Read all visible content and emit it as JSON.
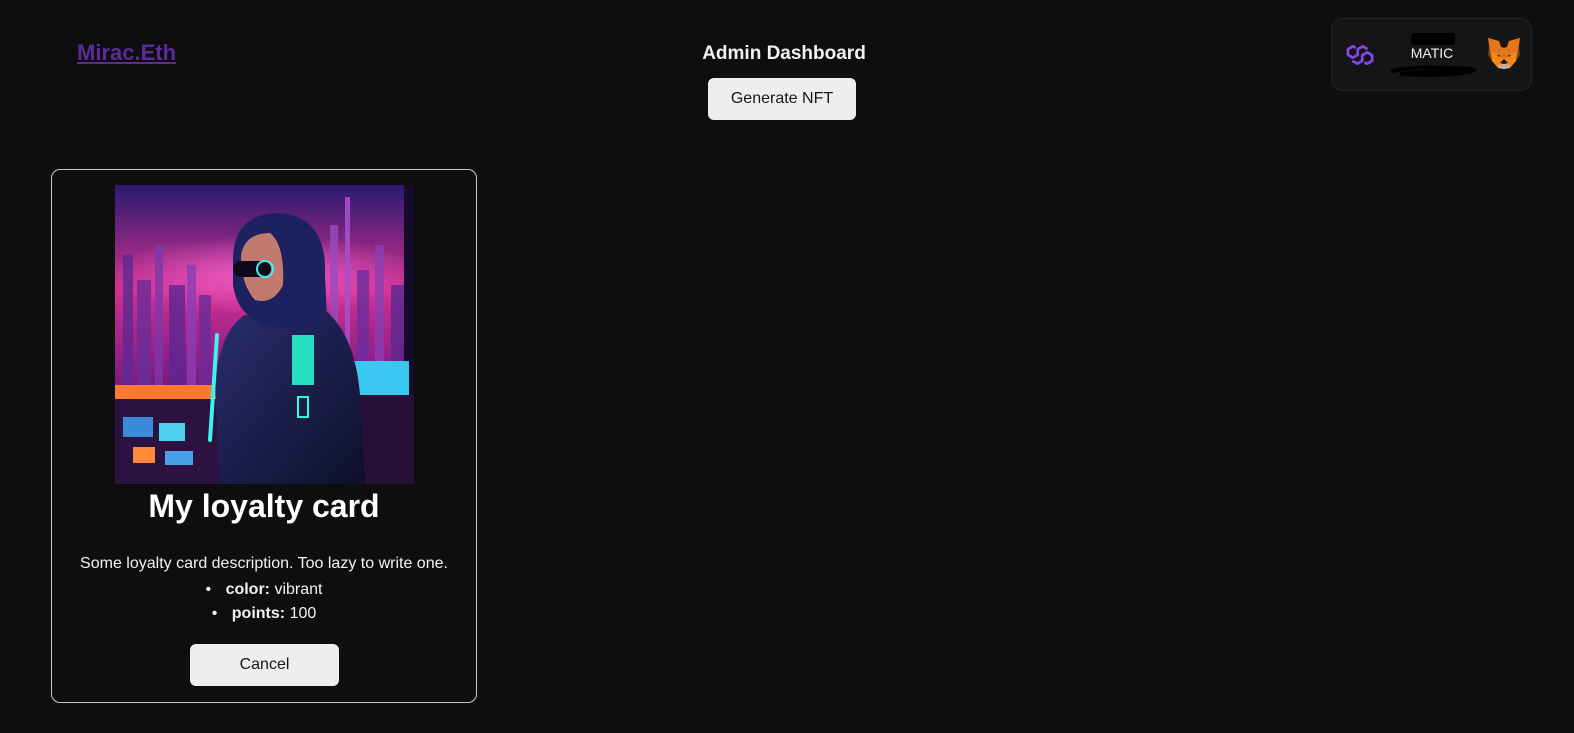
{
  "header": {
    "brand": "Mirac.Eth",
    "title": "Admin Dashboard",
    "generate_label": "Generate NFT"
  },
  "wallet": {
    "network_icon": "polygon-icon",
    "symbol": "MATIC",
    "wallet_icon": "metamask-fox-icon"
  },
  "card": {
    "image_icon": "cyberpunk-hooded-figure-image",
    "title": "My loyalty card",
    "description": "Some loyalty card description. Too lazy to write one.",
    "attributes": [
      {
        "key": "color:",
        "value": "vibrant"
      },
      {
        "key": "points:",
        "value": "100"
      }
    ],
    "cancel_label": "Cancel"
  },
  "colors": {
    "background": "#0e0e10",
    "brand_link": "#5b2b9b",
    "button_bg": "#eeeef0",
    "polygon": "#8247e5",
    "metamask": "#e2761b"
  }
}
